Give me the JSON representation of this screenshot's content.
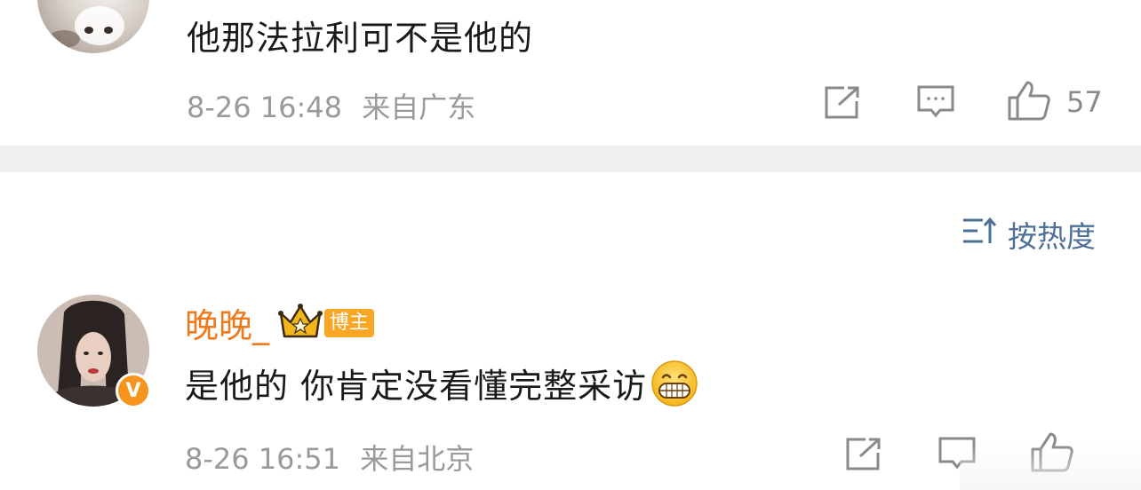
{
  "comment1": {
    "text": "他那法拉利可不是他的",
    "time": "8-26 16:48",
    "location": "来自广东",
    "like_count": "57"
  },
  "sort": {
    "label": "按热度"
  },
  "comment2": {
    "username": "晚晚_",
    "badge": "博主",
    "text": "是他的 你肯定没看懂完整采访",
    "emoji": "grinning-emoji",
    "time": "8-26 16:51",
    "location": "来自北京",
    "verified_mark": "V"
  },
  "icons": [
    "share-icon",
    "comment-icon",
    "like-icon",
    "crown-icon",
    "sort-icon"
  ],
  "colors": {
    "username": "#f07a1b",
    "badge": "#f8a623",
    "sort": "#4e6f96",
    "divider": "#f0f0f0"
  }
}
